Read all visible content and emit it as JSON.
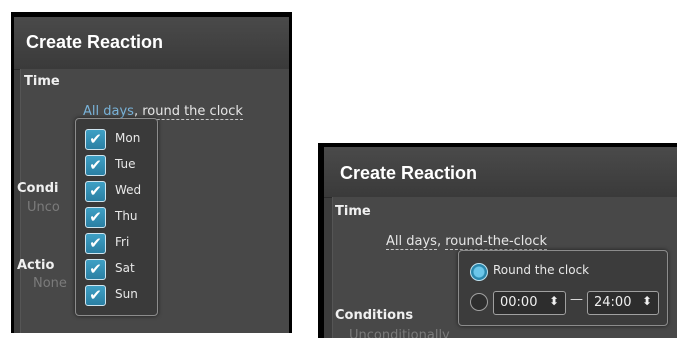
{
  "left_panel": {
    "title": "Create Reaction",
    "time_label": "Time",
    "summary": {
      "days": "All days",
      "sep": ", ",
      "hours": "round the clock"
    },
    "conditions_label": "Condi",
    "conditions_value": "Unco",
    "actions_label": "Actio",
    "actions_value": "None",
    "days": [
      {
        "label": "Mon",
        "checked": true
      },
      {
        "label": "Tue",
        "checked": true
      },
      {
        "label": "Wed",
        "checked": true
      },
      {
        "label": "Thu",
        "checked": true
      },
      {
        "label": "Fri",
        "checked": true
      },
      {
        "label": "Sat",
        "checked": true
      },
      {
        "label": "Sun",
        "checked": true
      }
    ],
    "check_glyph": "✔"
  },
  "right_panel": {
    "title": "Create Reaction",
    "time_label": "Time",
    "summary": {
      "days": "All days",
      "sep": ", ",
      "hours": "round-the-clock"
    },
    "conditions_label": "Conditions",
    "conditions_value": "Unconditionally",
    "round_the_clock_label": "Round the clock",
    "from_time": "00:00",
    "to_time": "24:00",
    "dash": "—",
    "spin_glyph": "⬍"
  },
  "colors": {
    "accent": "#3fa0c5",
    "link": "#79b3d9"
  }
}
